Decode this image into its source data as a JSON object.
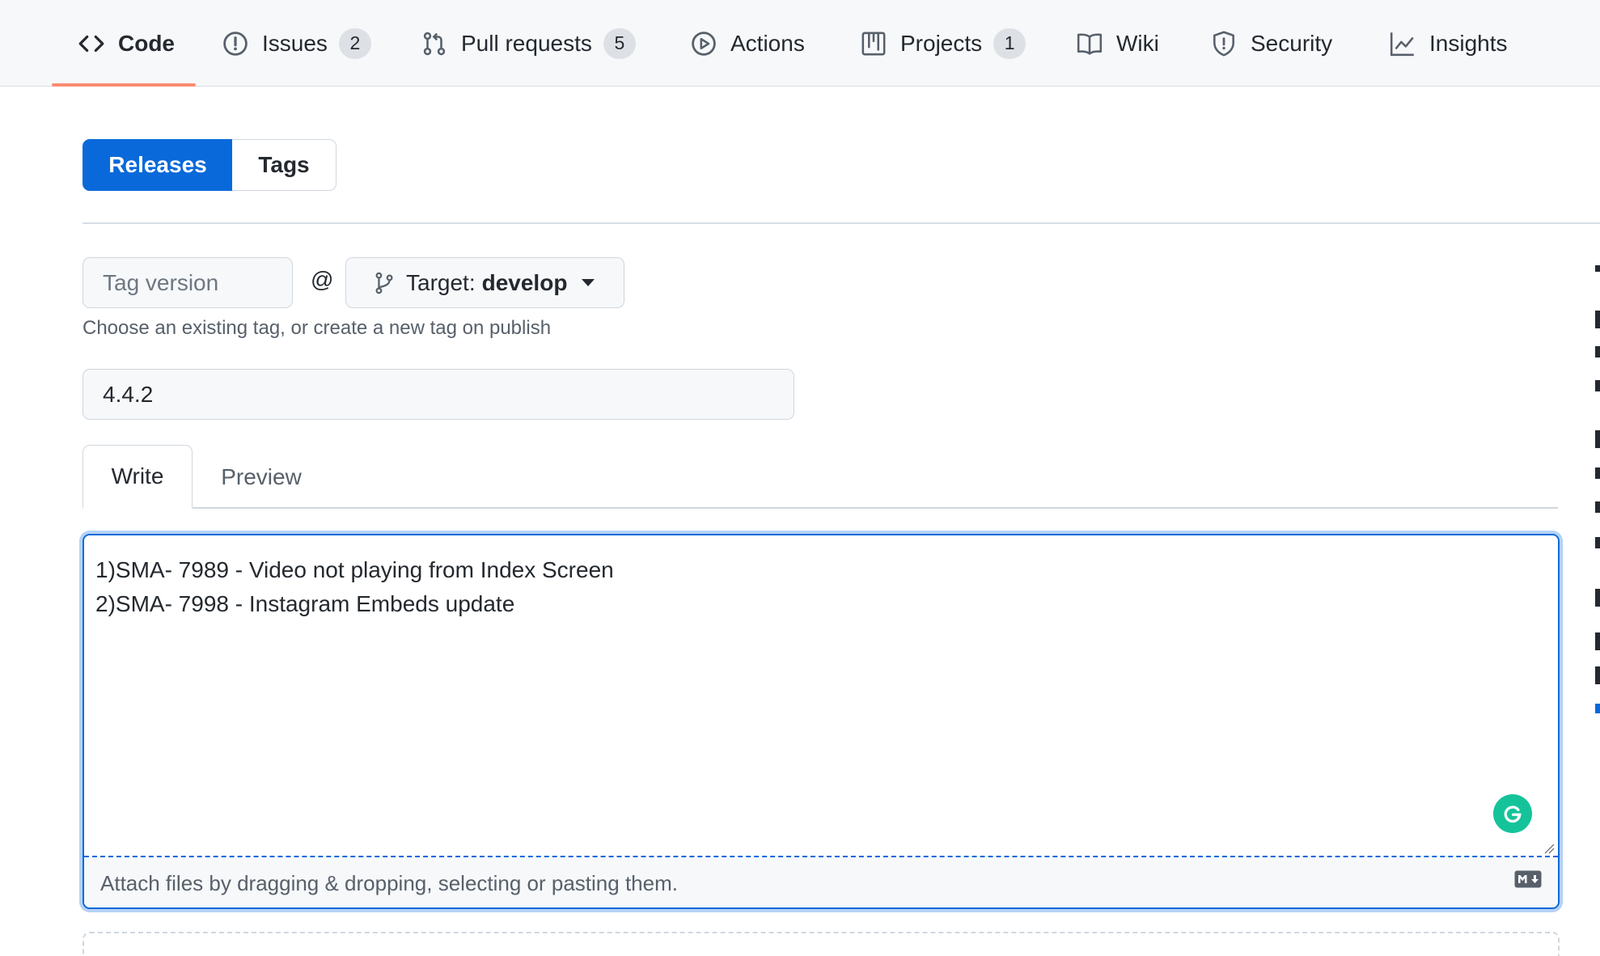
{
  "repo_nav": {
    "tabs": [
      {
        "label": "Code",
        "icon": "code-icon",
        "active": true
      },
      {
        "label": "Issues",
        "icon": "issue-icon",
        "count": "2"
      },
      {
        "label": "Pull requests",
        "icon": "pull-request-icon",
        "count": "5"
      },
      {
        "label": "Actions",
        "icon": "play-icon"
      },
      {
        "label": "Projects",
        "icon": "project-icon",
        "count": "1"
      },
      {
        "label": "Wiki",
        "icon": "book-icon"
      },
      {
        "label": "Security",
        "icon": "shield-icon"
      },
      {
        "label": "Insights",
        "icon": "graph-icon"
      }
    ]
  },
  "subnav": {
    "releases_label": "Releases",
    "tags_label": "Tags",
    "active": "Releases"
  },
  "release_form": {
    "tag_placeholder": "Tag version",
    "tag_value": "",
    "at_symbol": "@",
    "target_prefix": "Target:",
    "target_branch": "develop",
    "tag_hint": "Choose an existing tag, or create a new tag on publish",
    "title_value": "4.4.2",
    "editor_tabs": {
      "write": "Write",
      "preview": "Preview",
      "active": "Write"
    },
    "body_value": "1)SMA- 7989 - Video not playing from Index Screen\n2)SMA- 7998 - Instagram Embeds update",
    "attach_text": "Attach files by dragging & dropping, selecting or pasting them.",
    "markdown_icon": "markdown-icon",
    "grammarly_icon": "grammarly-icon"
  },
  "colors": {
    "accent": "#0969da",
    "active_tab_underline": "#fd8c73",
    "grammarly": "#15c39a"
  }
}
